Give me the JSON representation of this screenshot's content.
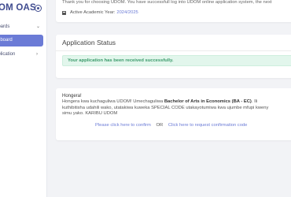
{
  "sidebar": {
    "brand": "OM OAS",
    "items": [
      {
        "label": "boards",
        "chevron": "⌄"
      },
      {
        "label": "shboard"
      },
      {
        "label": "pplication",
        "chevron": "›"
      }
    ]
  },
  "banner": {
    "thanks_text": "Thank you for choosing UDOM. You have successfull log into UDOM online application system, the next",
    "year_label": "Active Academic Year:",
    "year_value": "2024/2025"
  },
  "status": {
    "title": "Application Status",
    "success_message": "Your application has been received successfully."
  },
  "congrats": {
    "heading": "Hongera!",
    "line1_pre": "Hongera kwa kuchaguliwa UDOM! Umechaguliwa ",
    "program": "Bachelor of Arts in Economics (BA - EC)",
    "line1_post": ". Ili",
    "line2": "kuthibitisha udahili wako, utatakiwa kuweka SPECIAL CODE utakayotumiwa kwa ujumbe mfupi kweny",
    "line3": "simu yako. KARIBU UDOM",
    "confirm_link": "Please click here to confirm",
    "or_text": "OR",
    "request_link": "Click here to request confirmation code"
  },
  "colors": {
    "accent": "#6b7bd6",
    "brand": "#3f4b8f",
    "success_bg": "#e2f6ec",
    "success_text": "#3a9a6a"
  }
}
